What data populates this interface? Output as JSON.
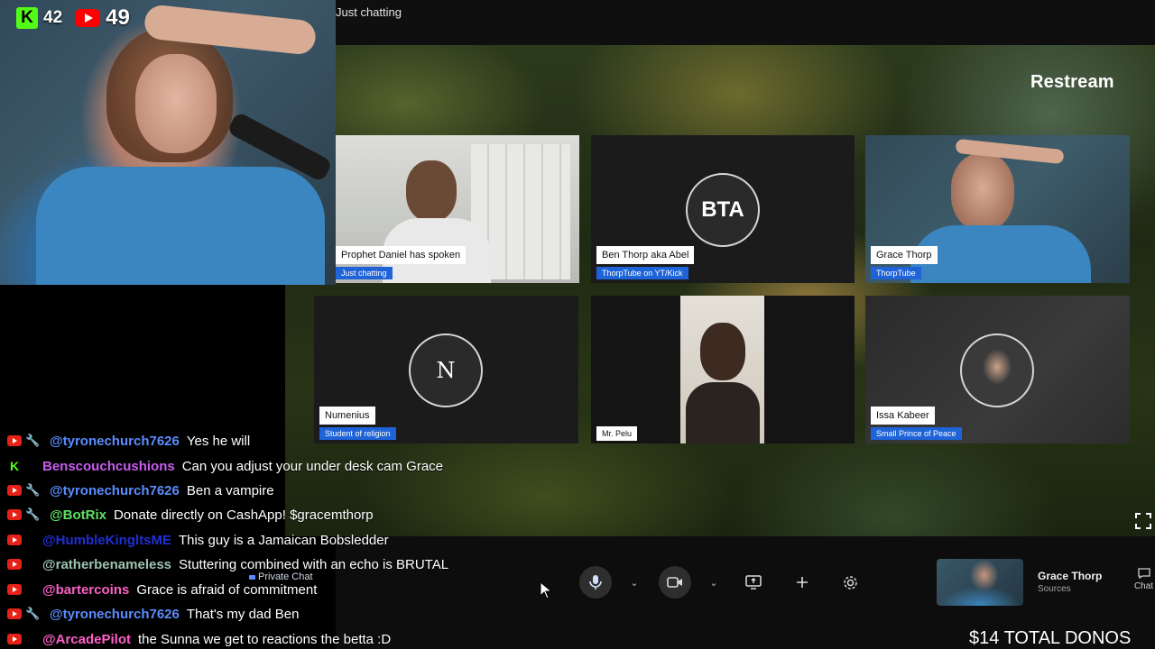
{
  "header": {
    "stream_title": "Just chatting"
  },
  "overlay": {
    "kick_viewers": "42",
    "youtube_viewers": "49",
    "brand": "Restream",
    "total_donos": "$14 TOTAL DONOS"
  },
  "tiles": [
    {
      "name": "Prophet Daniel has spoken",
      "subtitle": "Just chatting",
      "type": "camera"
    },
    {
      "name": "Ben Thorp aka Abel",
      "subtitle": "ThorpTube on YT/Kick",
      "type": "avatar",
      "initials": "BTA"
    },
    {
      "name": "Grace Thorp",
      "subtitle": "ThorpTube",
      "type": "camera"
    },
    {
      "name": "Numenius",
      "subtitle": "Student of religion",
      "type": "avatar",
      "initials": "N"
    },
    {
      "name": "Mr. Pelu",
      "subtitle": "",
      "type": "camera"
    },
    {
      "name": "Issa Kabeer",
      "subtitle": "Small Prince of Peace",
      "type": "avatar-photo"
    }
  ],
  "controls": {
    "private_chat_label": "Private Chat",
    "icons": [
      "microphone-icon",
      "camera-icon",
      "screen-share-icon",
      "plus-icon",
      "settings-icon"
    ]
  },
  "self_preview": {
    "name": "Grace Thorp",
    "sources_label": "Sources",
    "chat_label": "Chat"
  },
  "chat": {
    "messages": [
      {
        "platform": "youtube",
        "mod": true,
        "user": "@tyronechurch7626",
        "user_color": "#5b8cff",
        "text": "Yes he will"
      },
      {
        "platform": "kick",
        "mod": false,
        "user": "Benscouchcushions",
        "user_color": "#c85cf0",
        "text": "Can you adjust your under desk cam Grace"
      },
      {
        "platform": "youtube",
        "mod": true,
        "user": "@tyronechurch7626",
        "user_color": "#5b8cff",
        "text": "Ben a vampire"
      },
      {
        "platform": "youtube",
        "mod": true,
        "user": "@BotRix",
        "user_color": "#5fe05f",
        "text": "Donate directly on CashApp! $gracemthorp"
      },
      {
        "platform": "youtube",
        "mod": false,
        "user": "@HumbleKingltsME",
        "user_color": "#1f2fd6",
        "text": "This guy is a Jamaican Bobsledder"
      },
      {
        "platform": "youtube",
        "mod": false,
        "user": "@ratherbenameless",
        "user_color": "#9ec3b2",
        "text": "Stuttering combined with an echo is BRUTAL"
      },
      {
        "platform": "youtube",
        "mod": false,
        "user": "@bartercoins",
        "user_color": "#ff5fc8",
        "text": "Grace is afraid of commitment"
      },
      {
        "platform": "youtube",
        "mod": true,
        "user": "@tyronechurch7626",
        "user_color": "#5b8cff",
        "text": "That's my dad Ben"
      },
      {
        "platform": "youtube",
        "mod": false,
        "user": "@ArcadePilot",
        "user_color": "#ff5fc8",
        "text": "the Sunna we get to reactions the betta :D"
      }
    ]
  }
}
